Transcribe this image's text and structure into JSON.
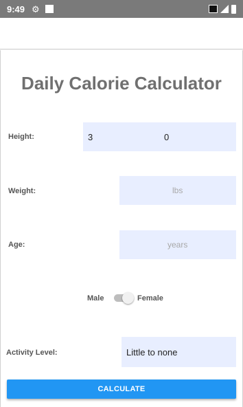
{
  "status_bar": {
    "time": "9:49",
    "icons": [
      "gear-icon",
      "notification-square-icon",
      "cast-icon",
      "signal-icon",
      "battery-icon"
    ]
  },
  "title": "Daily Calorie Calculator",
  "height": {
    "label": "Height:",
    "feet_value": "3",
    "inches_value": "0"
  },
  "weight": {
    "label": "Weight:",
    "placeholder": "lbs",
    "value": ""
  },
  "age": {
    "label": "Age:",
    "placeholder": "years",
    "value": ""
  },
  "gender": {
    "male_label": "Male",
    "female_label": "Female",
    "selected": "Female"
  },
  "activity": {
    "label": "Activity Level:",
    "value": "Little to none"
  },
  "calculate_label": "CALCULATE",
  "colors": {
    "status_bar": "#7a7a7a",
    "input_bg": "#e8eeff",
    "button": "#2196f3",
    "title": "#707070"
  }
}
